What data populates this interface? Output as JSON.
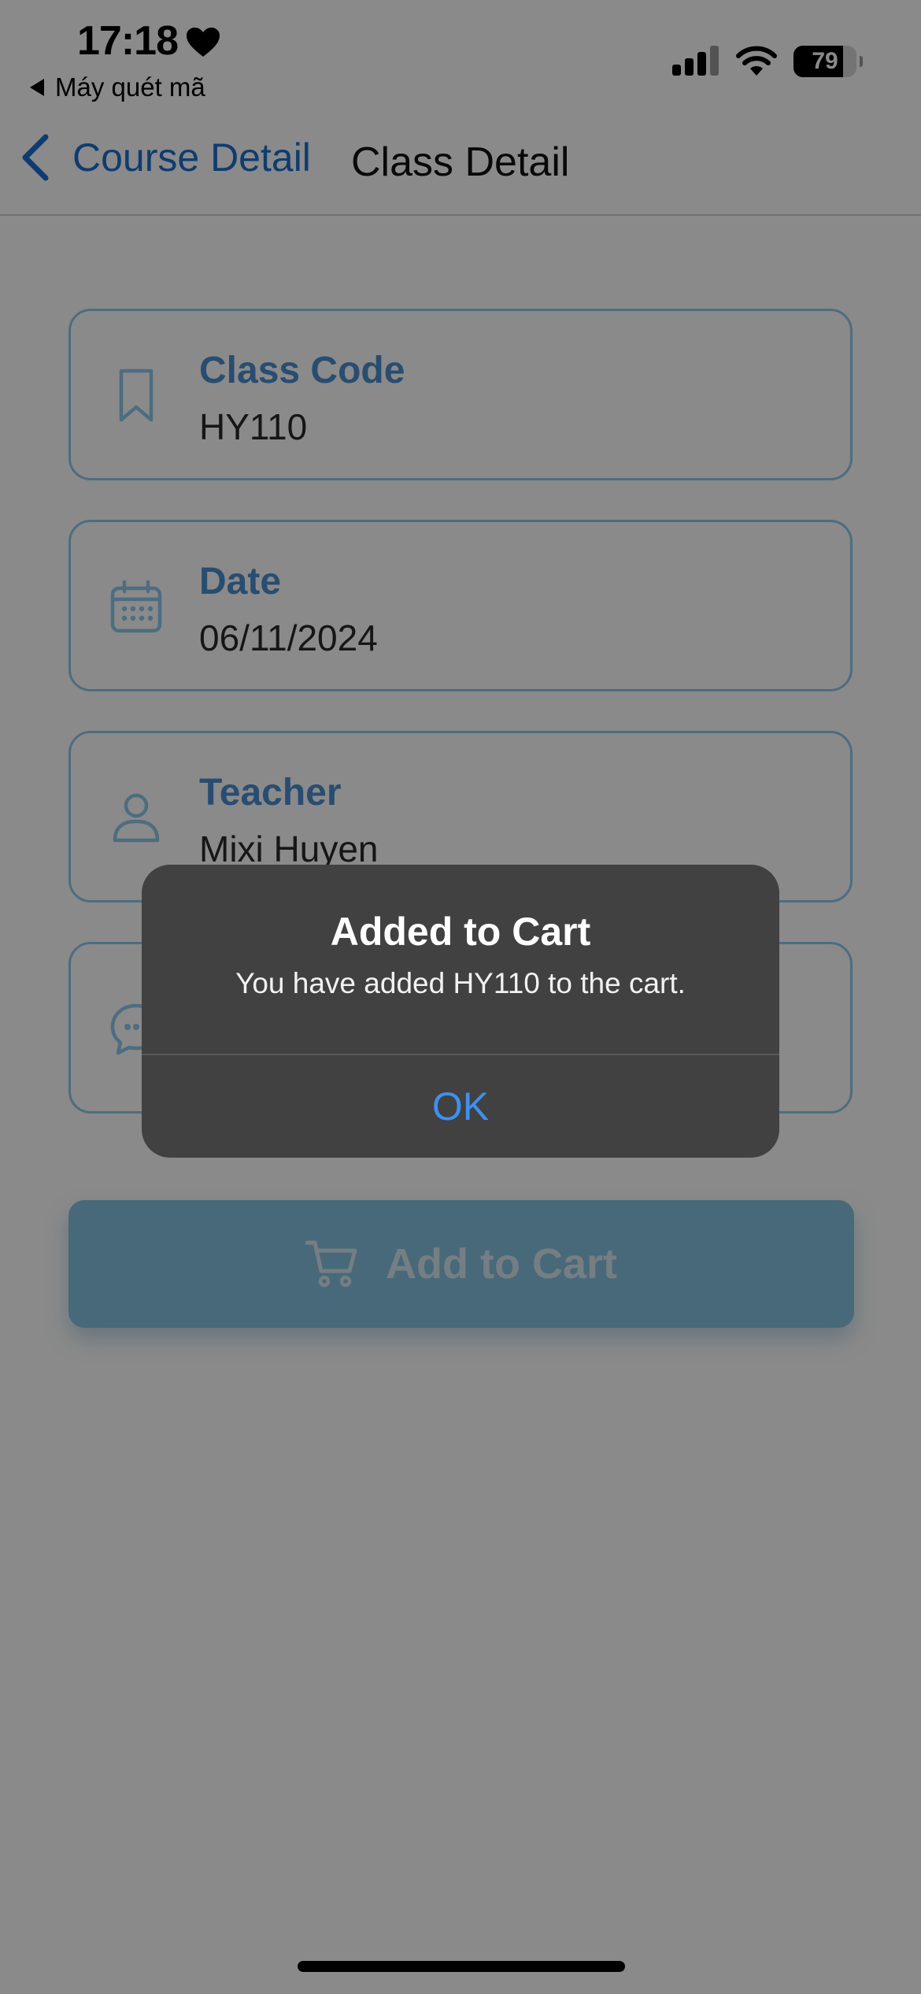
{
  "status_bar": {
    "time": "17:18",
    "back_app": "Máy quét mã",
    "battery": "79",
    "battery_level": 0.79,
    "heart_icon": "heart-icon",
    "signal_icon": "cellular-signal-icon",
    "wifi_icon": "wifi-icon"
  },
  "nav": {
    "back_label": "Course Detail",
    "title": "Class Detail",
    "accent_color": "#1a6fd1"
  },
  "cards": [
    {
      "label": "Class Code",
      "value": "HY110",
      "icon": "bookmark-icon"
    },
    {
      "label": "Date",
      "value": "06/11/2024",
      "icon": "calendar-icon"
    },
    {
      "label": "Teacher",
      "value": "Mixi Huyen",
      "icon": "person-icon"
    },
    {
      "label": "",
      "value": "",
      "icon": "chat-bubble-icon"
    }
  ],
  "add_to_cart": {
    "label": "Add to Cart",
    "icon": "cart-icon"
  },
  "alert": {
    "title": "Added to Cart",
    "message": "You have added HY110 to the cart.",
    "ok_label": "OK",
    "ok_color": "#3e90f0"
  }
}
